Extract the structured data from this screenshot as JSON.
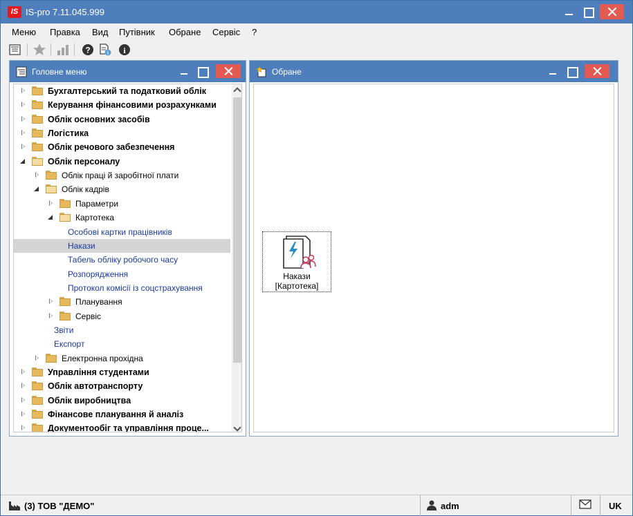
{
  "window": {
    "title": "IS-pro 7.11.045.999",
    "logo_text": "IS"
  },
  "menubar": [
    "Меню",
    "Правка",
    "Вид",
    "Путівник",
    "Обране",
    "Сервіс",
    "?"
  ],
  "toolbar": {
    "icons": [
      "window-list-icon",
      "star-icon",
      "chart-icon",
      "help-icon",
      "document-info-icon",
      "info-icon"
    ]
  },
  "left_panel": {
    "title": "Головне меню",
    "tree": [
      {
        "label": "Бухгалтерський та податковий облік",
        "level": 0,
        "state": "collapsed",
        "type": "folder",
        "bold": true
      },
      {
        "label": "Керування фінансовими розрахунками",
        "level": 0,
        "state": "collapsed",
        "type": "folder",
        "bold": true
      },
      {
        "label": "Облік основних засобів",
        "level": 0,
        "state": "collapsed",
        "type": "folder",
        "bold": true
      },
      {
        "label": "Логістика",
        "level": 0,
        "state": "collapsed",
        "type": "folder",
        "bold": true
      },
      {
        "label": "Облік речового забезпечення",
        "level": 0,
        "state": "collapsed",
        "type": "folder",
        "bold": true
      },
      {
        "label": "Облік персоналу",
        "level": 0,
        "state": "expanded",
        "type": "folder-open",
        "bold": true
      },
      {
        "label": "Облік праці й заробітної плати",
        "level": 1,
        "state": "collapsed",
        "type": "folder",
        "bold": false
      },
      {
        "label": "Облік кадрів",
        "level": 1,
        "state": "expanded",
        "type": "folder-open",
        "bold": false
      },
      {
        "label": "Параметри",
        "level": 2,
        "state": "collapsed",
        "type": "folder",
        "bold": false
      },
      {
        "label": "Картотека",
        "level": 2,
        "state": "expanded",
        "type": "folder-open",
        "bold": false
      },
      {
        "label": "Особові картки працівників",
        "level": 3,
        "state": "leaf",
        "type": "link",
        "bold": false
      },
      {
        "label": "Накази",
        "level": 3,
        "state": "leaf",
        "type": "link",
        "bold": false,
        "selected": true
      },
      {
        "label": "Табель обліку робочого часу",
        "level": 3,
        "state": "leaf",
        "type": "link",
        "bold": false
      },
      {
        "label": "Розпорядження",
        "level": 3,
        "state": "leaf",
        "type": "link",
        "bold": false
      },
      {
        "label": "Протокол комісії із соцстрахування",
        "level": 3,
        "state": "leaf",
        "type": "link",
        "bold": false
      },
      {
        "label": "Планування",
        "level": 2,
        "state": "collapsed",
        "type": "folder",
        "bold": false
      },
      {
        "label": "Сервіс",
        "level": 2,
        "state": "collapsed",
        "type": "folder",
        "bold": false
      },
      {
        "label": "Звіти",
        "level": 2,
        "state": "leaf",
        "type": "link",
        "bold": false
      },
      {
        "label": "Експорт",
        "level": 2,
        "state": "leaf",
        "type": "link",
        "bold": false
      },
      {
        "label": "Електронна прохідна",
        "level": 1,
        "state": "collapsed",
        "type": "folder",
        "bold": false
      },
      {
        "label": "Управління студентами",
        "level": 0,
        "state": "collapsed",
        "type": "folder",
        "bold": true
      },
      {
        "label": "Облік автотранспорту",
        "level": 0,
        "state": "collapsed",
        "type": "folder",
        "bold": true
      },
      {
        "label": "Облік виробництва",
        "level": 0,
        "state": "collapsed",
        "type": "folder",
        "bold": true
      },
      {
        "label": "Фінансове планування й аналіз",
        "level": 0,
        "state": "collapsed",
        "type": "folder",
        "bold": true
      },
      {
        "label": "Документообіг та управління проце...",
        "level": 0,
        "state": "collapsed",
        "type": "folder",
        "bold": true
      }
    ]
  },
  "right_panel": {
    "title": "Обране",
    "favorites": [
      {
        "line1": "Накази",
        "line2": "[Картотека]"
      }
    ]
  },
  "statusbar": {
    "company": "(3) ТОВ \"ДЕМО\"",
    "user": "adm",
    "language": "UK"
  },
  "colors": {
    "titlebar": "#4e7fbc",
    "close": "#e35a52",
    "link": "#1a3a9f",
    "selected_row": "#d4d4d4"
  }
}
